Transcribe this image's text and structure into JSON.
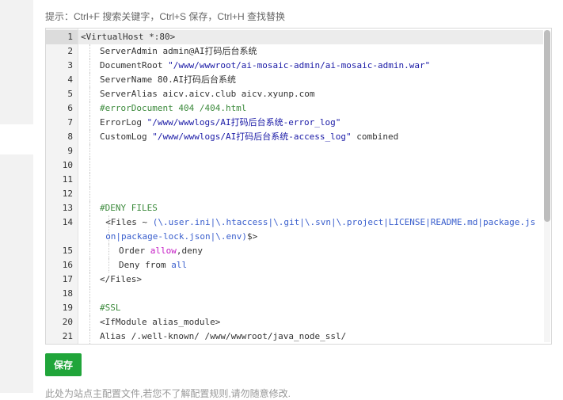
{
  "hint": "提示：Ctrl+F 搜索关键字，Ctrl+S 保存，Ctrl+H 查找替换",
  "editor": {
    "lines": [
      {
        "n": "1",
        "indent": 0,
        "active": true,
        "parts": [
          {
            "t": "<VirtualHost *:80>",
            "c": ""
          }
        ]
      },
      {
        "n": "2",
        "indent": 1,
        "parts": [
          {
            "t": "ServerAdmin admin@AI打码后台系统",
            "c": ""
          }
        ]
      },
      {
        "n": "3",
        "indent": 1,
        "parts": [
          {
            "t": "DocumentRoot ",
            "c": ""
          },
          {
            "t": "\"/www/wwwroot/ai-mosaic-admin/ai-mosaic-admin.war\"",
            "c": "str"
          }
        ]
      },
      {
        "n": "4",
        "indent": 1,
        "parts": [
          {
            "t": "ServerName 80.AI打码后台系统",
            "c": ""
          }
        ]
      },
      {
        "n": "5",
        "indent": 1,
        "parts": [
          {
            "t": "ServerAlias aicv.aicv.club aicv.xyunp.com",
            "c": ""
          }
        ]
      },
      {
        "n": "6",
        "indent": 1,
        "parts": [
          {
            "t": "#errorDocument 404 /404.html",
            "c": "cmt"
          }
        ]
      },
      {
        "n": "7",
        "indent": 1,
        "parts": [
          {
            "t": "ErrorLog ",
            "c": ""
          },
          {
            "t": "\"/www/wwwlogs/AI打码后台系统-error_log\"",
            "c": "str"
          }
        ]
      },
      {
        "n": "8",
        "indent": 1,
        "parts": [
          {
            "t": "CustomLog ",
            "c": ""
          },
          {
            "t": "\"/www/wwwlogs/AI打码后台系统-access_log\"",
            "c": "str"
          },
          {
            "t": " combined",
            "c": ""
          }
        ]
      },
      {
        "n": "9",
        "indent": 1,
        "parts": []
      },
      {
        "n": "10",
        "indent": 1,
        "parts": []
      },
      {
        "n": "11",
        "indent": 1,
        "parts": []
      },
      {
        "n": "12",
        "indent": 1,
        "parts": []
      },
      {
        "n": "13",
        "indent": 1,
        "parts": [
          {
            "t": "#DENY FILES",
            "c": "cmt"
          }
        ]
      },
      {
        "n": "14",
        "indent": 1.3,
        "wrap": true,
        "parts": [
          {
            "t": "<Files ~ ",
            "c": ""
          },
          {
            "t": "(\\.user.ini|\\.htaccess|\\.git|\\.svn|\\.project|LICENSE|README.md|package.json|package-lock.json|\\.env)",
            "c": "re"
          },
          {
            "t": "$>",
            "c": ""
          }
        ]
      },
      {
        "n": "15",
        "indent": 2,
        "parts": [
          {
            "t": "Order ",
            "c": ""
          },
          {
            "t": "allow",
            "c": "kw"
          },
          {
            "t": ",deny",
            "c": ""
          }
        ]
      },
      {
        "n": "16",
        "indent": 2,
        "parts": [
          {
            "t": "Deny from ",
            "c": ""
          },
          {
            "t": "all",
            "c": "val"
          }
        ]
      },
      {
        "n": "17",
        "indent": 1,
        "parts": [
          {
            "t": "</Files>",
            "c": ""
          }
        ]
      },
      {
        "n": "18",
        "indent": 1,
        "parts": []
      },
      {
        "n": "19",
        "indent": 1,
        "parts": [
          {
            "t": "#SSL",
            "c": "cmt"
          }
        ]
      },
      {
        "n": "20",
        "indent": 1,
        "parts": [
          {
            "t": "<IfModule alias_module>",
            "c": ""
          }
        ]
      },
      {
        "n": "21",
        "indent": 1,
        "parts": [
          {
            "t": "Alias /.well-known/ /www/wwwroot/java_node_ssl/",
            "c": ""
          }
        ]
      }
    ]
  },
  "save_label": "保存",
  "footnote": "此处为站点主配置文件,若您不了解配置规则,请勿随意修改."
}
